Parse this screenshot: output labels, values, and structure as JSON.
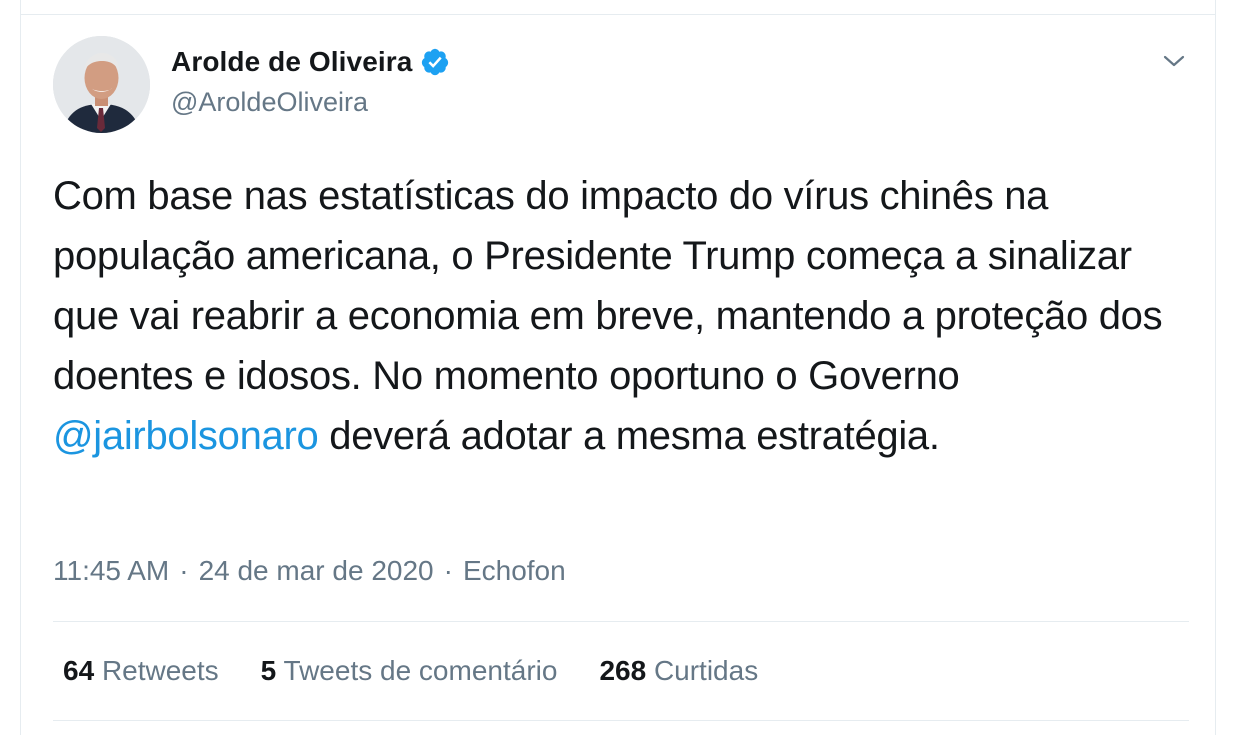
{
  "author": {
    "display_name": "Arolde de Oliveira",
    "handle": "@AroldeOliveira",
    "verified": true
  },
  "tweet": {
    "text_before": "Com base nas estatísticas do impacto do vírus chinês na população americana, o Presidente Trump começa a sinalizar que vai reabrir a economia em breve, mantendo a proteção dos doentes e idosos. No momento oportuno o Governo ",
    "mention": "@jairbolsonaro",
    "text_after": " deverá adotar a mesma estratégia."
  },
  "meta": {
    "time": "11:45 AM",
    "separator1": "·",
    "date": "24 de mar de 2020",
    "separator2": "·",
    "source": "Echofon"
  },
  "stats": {
    "retweets_count": "64",
    "retweets_label": "Retweets",
    "comments_count": "5",
    "comments_label": "Tweets de comentário",
    "likes_count": "268",
    "likes_label": "Curtidas"
  },
  "colors": {
    "text": "#14171a",
    "secondary": "#657786",
    "link": "#1b95e0",
    "verified": "#1da1f2",
    "border": "#e6ecf0"
  }
}
